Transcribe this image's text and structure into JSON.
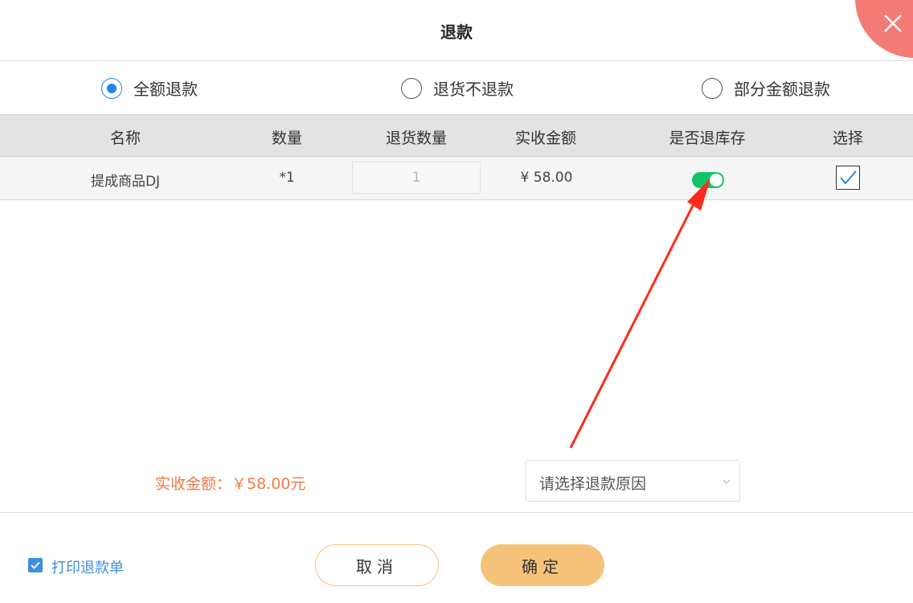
{
  "dialog": {
    "title": "退款"
  },
  "refund_types": [
    {
      "label": "全额退款",
      "checked": true
    },
    {
      "label": "退货不退款",
      "checked": false
    },
    {
      "label": "部分金额退款",
      "checked": false
    }
  ],
  "table": {
    "columns": [
      "名称",
      "数量",
      "退货数量",
      "实收金额",
      "是否退库存",
      "选择"
    ],
    "rows": [
      {
        "name": "提成商品DJ",
        "quantity": "*1",
        "return_quantity": "1",
        "amount": "¥ 58.00",
        "return_stock": true,
        "selected": true
      }
    ]
  },
  "summary": {
    "text": "实收金额：￥58.00元"
  },
  "reason": {
    "placeholder": "请选择退款原因"
  },
  "footer": {
    "print_label": "打印退款单",
    "print_checked": true,
    "cancel_label": "取消",
    "ok_label": "确定"
  },
  "colors": {
    "accent_blue": "#1e88e5",
    "close_red": "#f47a75",
    "toggle_green": "#13c26a",
    "button_orange": "#f6c27a",
    "summary_orange": "#f07a4a"
  }
}
